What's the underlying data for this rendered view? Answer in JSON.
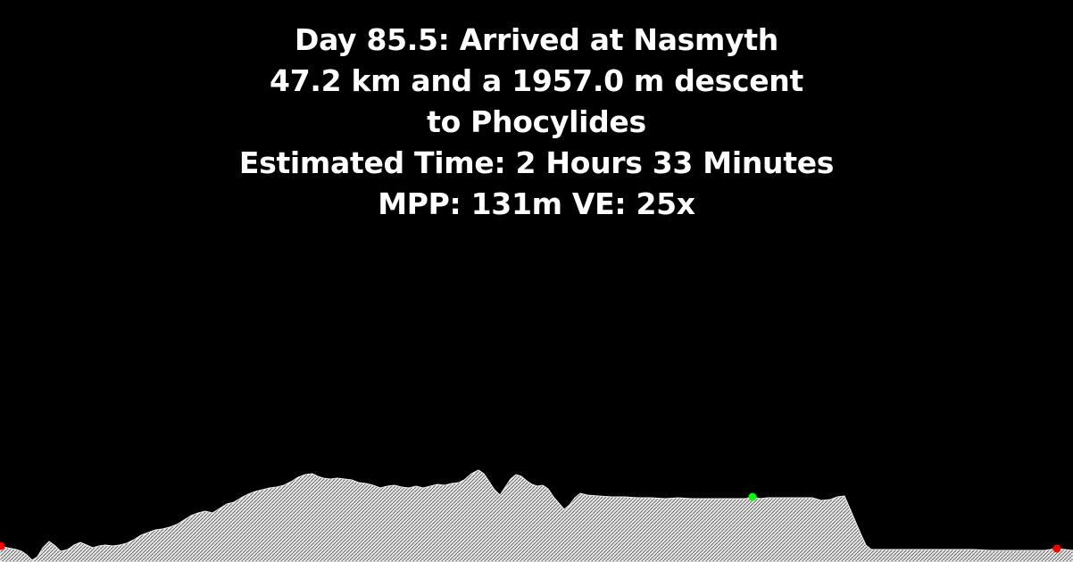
{
  "caption": {
    "line1": "Day 85.5: Arrived at Nasmyth",
    "line2": "47.2 km and a 1957.0 m descent",
    "line3": "to Phocylides",
    "line4": "Estimated Time: 2 Hours 33 Minutes",
    "line5": "MPP: 131m VE: 25x"
  },
  "colors": {
    "background": "#000000",
    "text": "#ffffff",
    "terrain_fill": "#e6e6e6",
    "terrain_hatch": "#555555",
    "start_marker": "#ff0000",
    "end_marker": "#ff0000",
    "current_marker": "#00ff00"
  }
}
